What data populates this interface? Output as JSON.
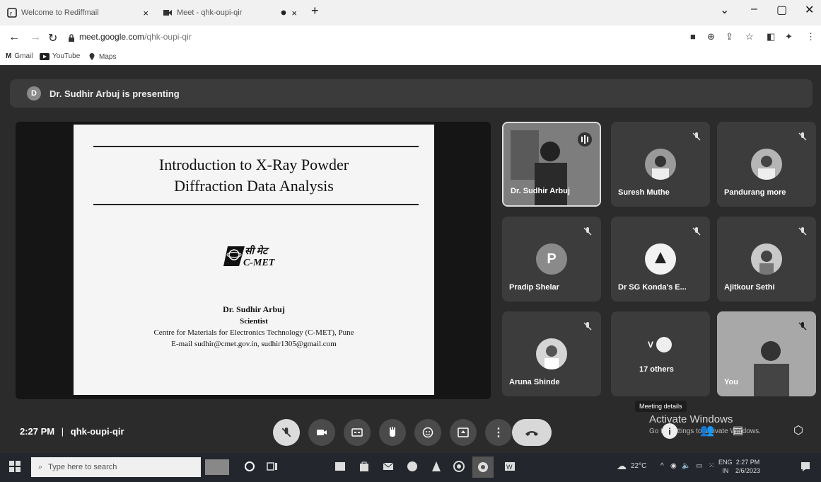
{
  "tabs": [
    {
      "title": "Welcome to Rediffmail",
      "close": "×"
    },
    {
      "title": "Meet - qhk-oupi-qir",
      "close": "×"
    }
  ],
  "new_tab": "+",
  "window_controls": [
    "⌄",
    "–",
    "▢",
    "✕"
  ],
  "address": {
    "domain": "meet.google.com",
    "path": "/qhk-oupi-qir"
  },
  "bookmarks": [
    {
      "label": "Gmail",
      "icon": "gmail-icon"
    },
    {
      "label": "YouTube",
      "icon": "youtube-icon"
    },
    {
      "label": "Maps",
      "icon": "maps-icon"
    }
  ],
  "banner": {
    "avatar_letter": "D",
    "text": "Dr. Sudhir Arbuj is presenting"
  },
  "slide": {
    "title_line1": "Introduction to X-Ray Powder",
    "title_line2": "Diffraction Data Analysis",
    "logo_text_hindi": "सी मेट",
    "logo_text": "C-MET",
    "presenter": "Dr. Sudhir Arbuj",
    "role": "Scientist",
    "org": "Centre for Materials for Electronics Technology (C-MET), Pune",
    "email": "E-mail sudhir@cmet.gov.in, sudhir1305@gmail.com"
  },
  "participants": [
    {
      "name": "Dr. Sudhir Arbuj",
      "kind": "video-speaking"
    },
    {
      "name": "Suresh Muthe",
      "kind": "photo"
    },
    {
      "name": "Pandurang more",
      "kind": "photo"
    },
    {
      "name": "Pradip Shelar",
      "kind": "letter",
      "letter": "P"
    },
    {
      "name": "Dr SG Konda's E...",
      "kind": "photo"
    },
    {
      "name": "Ajitkour Sethi",
      "kind": "photo"
    },
    {
      "name": "Aruna Shinde",
      "kind": "photo"
    },
    {
      "name": "17 others",
      "kind": "others",
      "letter": "V"
    },
    {
      "name": "You",
      "kind": "video"
    }
  ],
  "bottom": {
    "time": "2:27 PM",
    "separator": "|",
    "meeting_code": "qhk-oupi-qir",
    "tooltip": "Meeting details",
    "activate_title": "Activate Windows",
    "activate_sub": "Go to Settings to activate Windows."
  },
  "taskbar": {
    "search_placeholder": "Type here to search",
    "weather": "22°C",
    "lang_top": "ENG",
    "lang_bottom": "IN",
    "clock_time": "2:27 PM",
    "clock_date": "2/6/2023"
  },
  "colors": {
    "end_call": "#e0e0e0",
    "meet_bg": "#2b2b2b",
    "taskbar": "#23272d"
  }
}
